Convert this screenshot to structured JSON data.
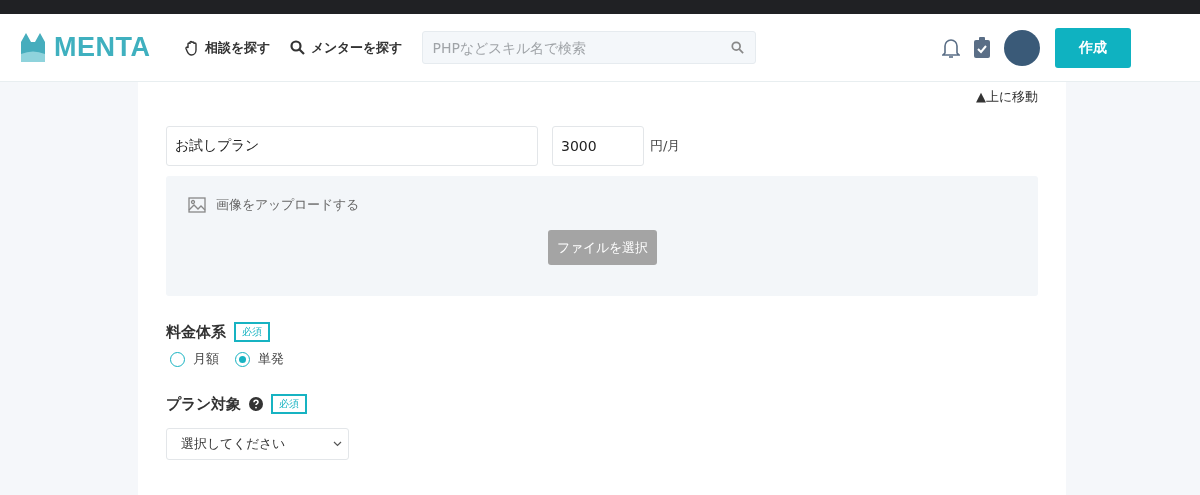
{
  "header": {
    "logo": "MENTA",
    "nav": [
      {
        "label": "相談を探す",
        "kind": "hand"
      },
      {
        "label": "メンターを探す",
        "kind": "search"
      }
    ],
    "search": {
      "placeholder": "PHPなどスキル名で検索"
    },
    "create_button": "作成"
  },
  "form": {
    "top_link": "▲上に移動",
    "plan_name": "お試しプラン",
    "price": "3000",
    "price_unit": "円/月",
    "upload_label": "画像をアップロードする",
    "file_button": "ファイルを選択",
    "pricing": {
      "label": "料金体系",
      "required": "必須",
      "options": [
        {
          "label": "月額",
          "selected": false
        },
        {
          "label": "単発",
          "selected": true
        }
      ]
    },
    "target": {
      "label": "プラン対象",
      "required": "必須",
      "select": "選択してください"
    }
  }
}
